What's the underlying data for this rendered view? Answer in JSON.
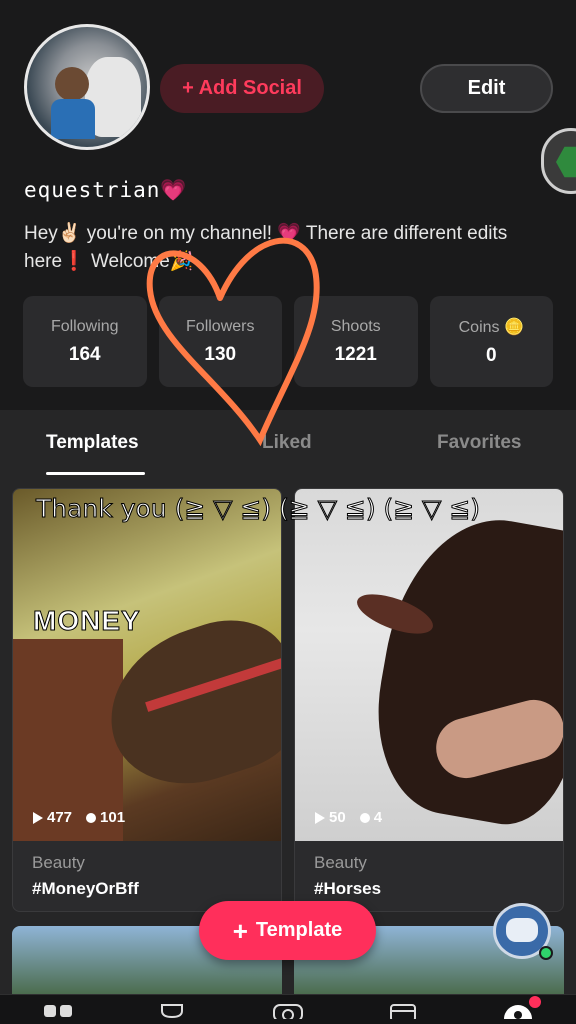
{
  "profile": {
    "username": "equestrian💗",
    "bio": "Hey✌🏻 you're on my channel! 💗 There are different edits here❗ Welcome🎉",
    "add_social_label": "+ Add Social",
    "edit_label": "Edit"
  },
  "stats": [
    {
      "label": "Following",
      "value": "164"
    },
    {
      "label": "Followers",
      "value": "130"
    },
    {
      "label": "Shoots",
      "value": "1221"
    },
    {
      "label": "Coins 🪙",
      "value": "0"
    }
  ],
  "tabs": {
    "templates": "Templates",
    "liked": "Liked",
    "favorites": "Favorites",
    "active": "Templates"
  },
  "overlay_text": "Thank you (≧ ▽ ≦) (≧ ▽ ≦) (≧ ▽ ≦)",
  "cards": [
    {
      "thumb_text": "MONEY",
      "plays": "477",
      "likes": "101",
      "category": "Beauty",
      "tag": "#MoneyOrBff"
    },
    {
      "plays": "50",
      "likes": "4",
      "category": "Beauty",
      "tag": "#Horses"
    }
  ],
  "template_button": "Template",
  "colors": {
    "accent": "#ff2f5b",
    "background": "#1a1a1b",
    "card": "#2b2b2d",
    "heart_stroke": "#ff7a45"
  },
  "icons": [
    "avatar",
    "hexagon-badge-icon",
    "play-icon",
    "like-dot-icon",
    "plus-icon",
    "assistant-bot-icon",
    "home-icon",
    "trophy-icon",
    "camera-icon",
    "calendar-icon",
    "profile-icon"
  ]
}
